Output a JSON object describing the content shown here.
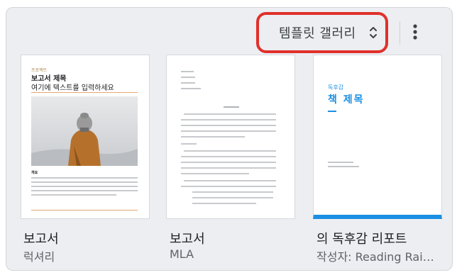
{
  "header": {
    "gallery_label": "템플릿 갤러리"
  },
  "thumbnails": {
    "report": {
      "small_label": "프로젝트",
      "heading1": "보고서 제목",
      "heading2": "여기에 텍스트를 입력하세요",
      "section_label": "개요"
    },
    "book": {
      "small_label": "독후감",
      "title": "책 제목"
    }
  },
  "templates": [
    {
      "title": "보고서",
      "subtitle": "럭셔리"
    },
    {
      "title": "보고서",
      "subtitle": "MLA"
    },
    {
      "title": "의 독후감 리포트",
      "subtitle": "작성자: Reading Rainbow"
    }
  ],
  "colors": {
    "accent": "#1a8fe3",
    "highlight": "#e0302b",
    "report_rule": "#e3a870"
  }
}
